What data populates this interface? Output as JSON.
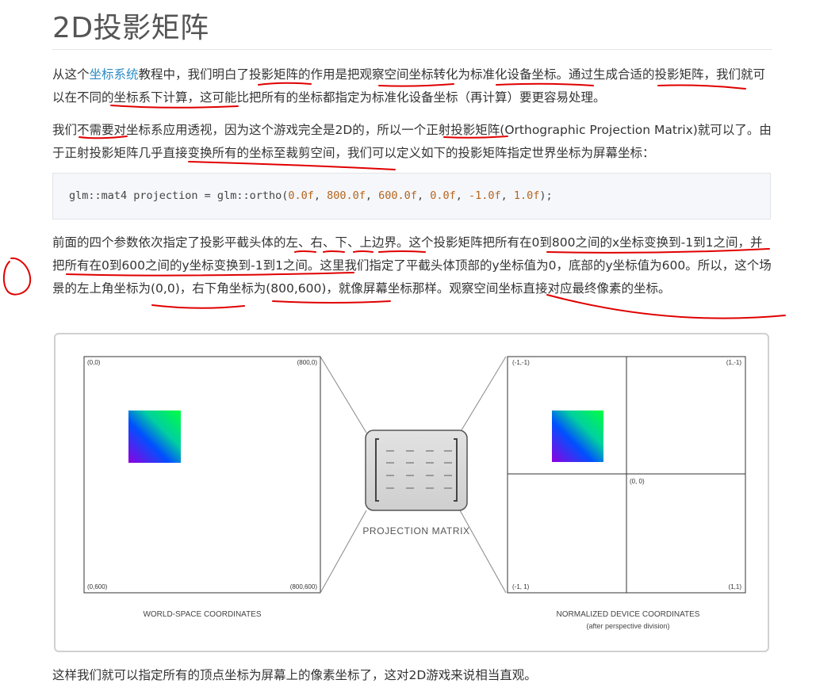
{
  "title": "2D投影矩阵",
  "para1": {
    "t1": "从这个",
    "link": "坐标系统",
    "t2": "教程中，我们明白了投影矩阵的作用是把观察空间坐标转化为标准化设备坐标。通过生成合适的投影矩阵，我们就可以在不同的坐标系下计算，这可能比把所有的坐标都指定为标准化设备坐标（再计算）要更容易处理。"
  },
  "para2": "我们不需要对坐标系应用透视，因为这个游戏完全是2D的，所以一个正射投影矩阵(Orthographic Projection Matrix)就可以了。由于正射投影矩阵几乎直接变换所有的坐标至裁剪空间，我们可以定义如下的投影矩阵指定世界坐标为屏幕坐标：",
  "code": {
    "prefix": "glm::mat4 projection = glm::ortho(",
    "args": [
      "0.0f",
      "800.0f",
      "600.0f",
      "0.0f",
      "-1.0f",
      "1.0f"
    ],
    "suffix": ");"
  },
  "para3": "前面的四个参数依次指定了投影平截头体的左、右、下、上边界。这个投影矩阵把所有在0到800之间的x坐标变换到-1到1之间，并把所有在0到600之间的y坐标变换到-1到1之间。这里我们指定了平截头体顶部的y坐标值为0，底部的y坐标值为600。所以，这个场景的左上角坐标为(0,0)，右下角坐标为(800,600)，就像屏幕坐标那样。观察空间坐标直接对应最终像素的坐标。",
  "para4": "这样我们就可以指定所有的顶点坐标为屏幕上的像素坐标了，这对2D游戏来说相当直观。",
  "figure": {
    "world": {
      "top_left": "(0,0)",
      "top_right": "(800,0)",
      "bottom_left": "(0,600)",
      "bottom_right": "(800,600)",
      "caption": "WORLD-SPACE COORDINATES"
    },
    "matrix_label": "PROJECTION MATRIX",
    "ndc": {
      "top_left": "(-1,-1)",
      "top_right": "(1,-1)",
      "center": "(0, 0)",
      "bottom_left": "(-1, 1)",
      "bottom_right": "(1,1)",
      "caption": "NORMALIZED DEVICE COORDINATES",
      "subcaption": "(after perspective division)"
    }
  },
  "colors": {
    "link": "#2b8bc6",
    "annotation": "#e00000",
    "code_bg": "#f5f7fb"
  }
}
